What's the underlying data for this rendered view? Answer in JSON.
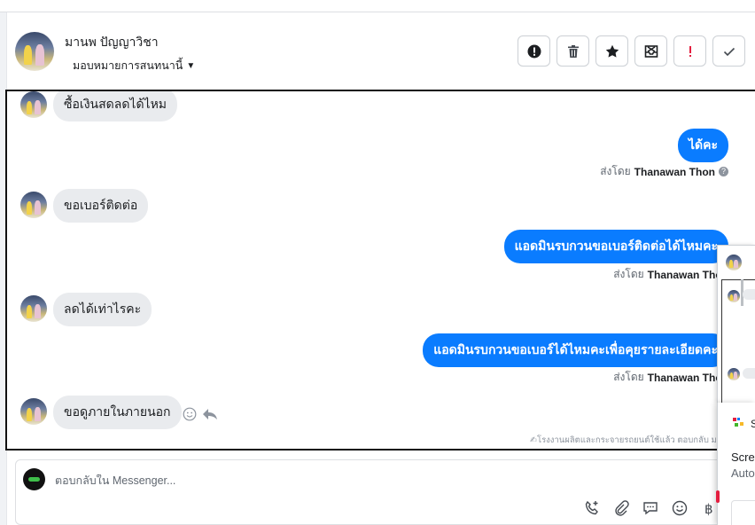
{
  "header": {
    "contact_name": "มานพ ปัญญาวิชา",
    "assign_label": "มอบหมายการสนทนานี้",
    "actions": [
      {
        "icon": "alert-circle-icon",
        "name": "mark-spam-button"
      },
      {
        "icon": "trash-icon",
        "name": "delete-button"
      },
      {
        "icon": "star-icon",
        "name": "star-button"
      },
      {
        "icon": "archive-icon",
        "name": "archive-button"
      },
      {
        "icon": "exclamation-icon",
        "name": "follow-up-button"
      },
      {
        "icon": "check-icon",
        "name": "mark-done-button"
      }
    ]
  },
  "messages": [
    {
      "direction": "in",
      "text": "ซื้อเงินสดลดได้ไหม"
    },
    {
      "direction": "out",
      "text": "ได้คะ",
      "sent_by_label": "ส่งโดย",
      "sender": "Thanawan Thon"
    },
    {
      "direction": "in",
      "text": "ขอเบอร์ติดต่อ"
    },
    {
      "direction": "out",
      "text": "แอดมินรบกวนขอเบอร์ติดต่อได้ไหมคะ",
      "sent_by_label": "ส่งโดย",
      "sender": "Thanawan Thon"
    },
    {
      "direction": "in",
      "text": "ลดได้เท่าไรคะ"
    },
    {
      "direction": "out",
      "text": "แอดมินรบกวนขอเบอร์ได้ไหมคะเพื่อคุยรายละเอียดคะ",
      "sent_by_label": "ส่งโดย",
      "sender": "Thanawan Thon"
    },
    {
      "direction": "in",
      "text": "ขอดูภายในภายนอก"
    }
  ],
  "footer_note": "✍โรงงานผลิตและกระจายรถยนต์ใช้แล้ว ตอบกลับ มา",
  "composer": {
    "placeholder": "ตอบกลับใน Messenger...",
    "tools": [
      "phone-plus-icon",
      "paperclip-icon",
      "chat-bubble-icon",
      "smiley-icon",
      "baht-icon"
    ]
  },
  "notification": {
    "title": "S",
    "line1": "Scre",
    "line2": "Auto"
  },
  "colors": {
    "outgoing_bubble": "#0a7cff",
    "incoming_bubble": "#e9ebee",
    "text_primary": "#1c1e21",
    "text_secondary": "#606770",
    "danger": "#e41e3f"
  }
}
